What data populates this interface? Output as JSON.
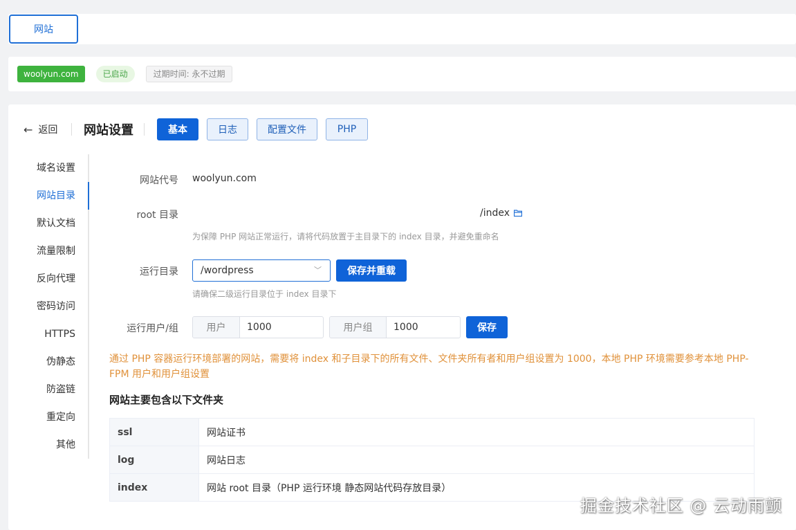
{
  "top_tab": {
    "label": "网站"
  },
  "status": {
    "site_tag": "woolyun.com",
    "running": "已启动",
    "expire": "过期时间: 永不过期"
  },
  "header": {
    "back_label": "返回",
    "title": "网站设置",
    "tabs": [
      "基本",
      "日志",
      "配置文件",
      "PHP"
    ],
    "active_tab": "基本"
  },
  "sidebar": {
    "items": [
      "域名设置",
      "网站目录",
      "默认文档",
      "流量限制",
      "反向代理",
      "密码访问",
      "HTTPS",
      "伪静态",
      "防盗链",
      "重定向",
      "其他"
    ],
    "active": "网站目录"
  },
  "form": {
    "site_code_label": "网站代号",
    "site_code_value": "woolyun.com",
    "root_label": "root 目录",
    "root_value": "/index",
    "root_hint": "为保障 PHP 网站正常运行，请将代码放置于主目录下的 index 目录，并避免重命名",
    "run_dir_label": "运行目录",
    "run_dir_value": "/wordpress",
    "save_reload_label": "保存并重载",
    "run_dir_hint": "请确保二级运行目录位于 index 目录下",
    "user_group_label": "运行用户/组",
    "user_prefix": "用户",
    "user_value": "1000",
    "group_prefix": "用户组",
    "group_value": "1000",
    "save_label": "保存"
  },
  "warning": "通过 PHP 容器运行环境部署的网站，需要将 index 和子目录下的所有文件、文件夹所有者和用户组设置为 1000，本地 PHP 环境需要参考本地 PHP-FPM 用户和用户组设置",
  "folders": {
    "title": "网站主要包含以下文件夹",
    "rows": [
      {
        "name": "ssl",
        "desc": "网站证书"
      },
      {
        "name": "log",
        "desc": "网站日志"
      },
      {
        "name": "index",
        "desc": "网站 root 目录（PHP 运行环境 静态网站代码存放目录）"
      }
    ]
  },
  "watermark": "掘金技术社区 @ 云动雨颤",
  "colors": {
    "primary": "#0f63d8",
    "success": "#3eb33e",
    "warning": "#e0913a"
  }
}
